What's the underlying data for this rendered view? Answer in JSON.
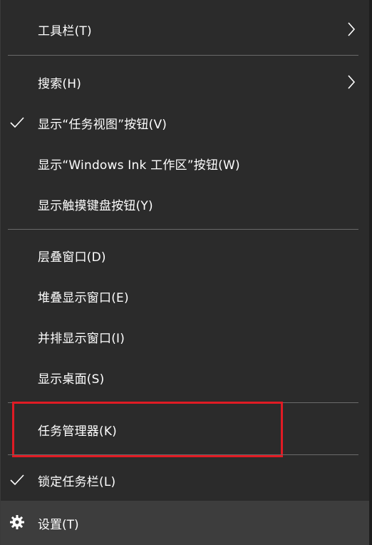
{
  "menu": {
    "items": [
      {
        "label": "工具栏(T)",
        "checked": false,
        "submenu": true
      },
      {
        "label": "搜索(H)",
        "checked": false,
        "submenu": true
      },
      {
        "label": "显示“任务视图”按钮(V)",
        "checked": true,
        "submenu": false
      },
      {
        "label": "显示“Windows Ink 工作区”按钮(W)",
        "checked": false,
        "submenu": false
      },
      {
        "label": "显示触摸键盘按钮(Y)",
        "checked": false,
        "submenu": false
      },
      {
        "label": "层叠窗口(D)",
        "checked": false,
        "submenu": false
      },
      {
        "label": "堆叠显示窗口(E)",
        "checked": false,
        "submenu": false
      },
      {
        "label": "并排显示窗口(I)",
        "checked": false,
        "submenu": false
      },
      {
        "label": "显示桌面(S)",
        "checked": false,
        "submenu": false
      },
      {
        "label": "任务管理器(K)",
        "checked": false,
        "submenu": false,
        "highlighted": true
      },
      {
        "label": "锁定任务栏(L)",
        "checked": true,
        "submenu": false
      }
    ],
    "settings": {
      "label": "设置(T)",
      "icon": "gear-icon"
    }
  },
  "colors": {
    "background": "#2b2b2b",
    "separator": "#6a6a6a",
    "highlight_border": "#e01b24",
    "settings_bg": "#3d3d3d",
    "text": "#ffffff"
  }
}
